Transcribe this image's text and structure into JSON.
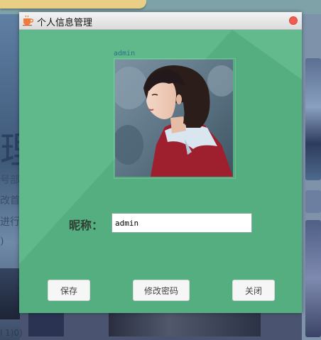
{
  "dialog": {
    "title": "个人信息管理",
    "avatar_caption": "admin",
    "nickname_label": "昵称：",
    "nickname_value": "admin",
    "buttons": {
      "save": "保存",
      "change_password": "修改密码",
      "close": "关闭"
    }
  },
  "background": {
    "left_text_big": "理",
    "left_lines": [
      "号部",
      "改首",
      "进行",
      ")"
    ],
    "bottom_text": "l 1)0)"
  },
  "colors": {
    "dialog_bg": "#5fb98b",
    "close_button": "#ef5d4f",
    "titlebar": "#e8e8e8"
  },
  "icons": {
    "title": "coffee-cup-icon",
    "close": "close-icon"
  }
}
